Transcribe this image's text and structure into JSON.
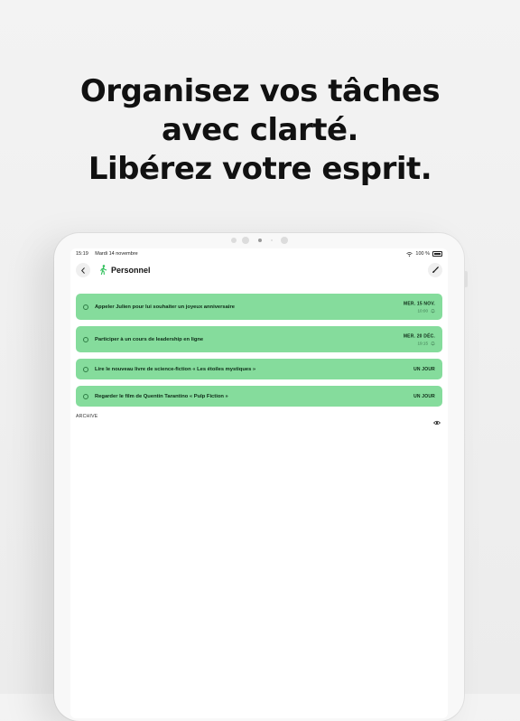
{
  "headline": {
    "line1": "Organisez vos tâches",
    "line2": "avec clarté.",
    "line3": "Libérez votre esprit."
  },
  "status_bar": {
    "time": "15:19",
    "date": "Mardi 14 novembre",
    "battery": "100 %"
  },
  "nav": {
    "title": "Personnel",
    "icons": [
      "chevron-left-icon",
      "walking-person-icon",
      "brush-icon"
    ]
  },
  "tasks": [
    {
      "title": "Appeler Julien pour lui souhaiter un joyeux anniversaire",
      "date": "MER. 15 NOV.",
      "time": "10:00"
    },
    {
      "title": "Participer à un cours de leadership en ligne",
      "date": "MER. 20 DÉC.",
      "time": "19:15"
    },
    {
      "title": "Lire le nouveau livre de science-fiction « Les étoiles mystiques »",
      "date": "UN JOUR"
    },
    {
      "title": "Regarder le film de Quentin Tarantino « Pulp Fiction »",
      "date": "UN JOUR"
    }
  ],
  "archive": {
    "label": "ARCHIVE"
  },
  "colors": {
    "task_bg": "#85dc9c",
    "accent": "#2fbf5a"
  }
}
